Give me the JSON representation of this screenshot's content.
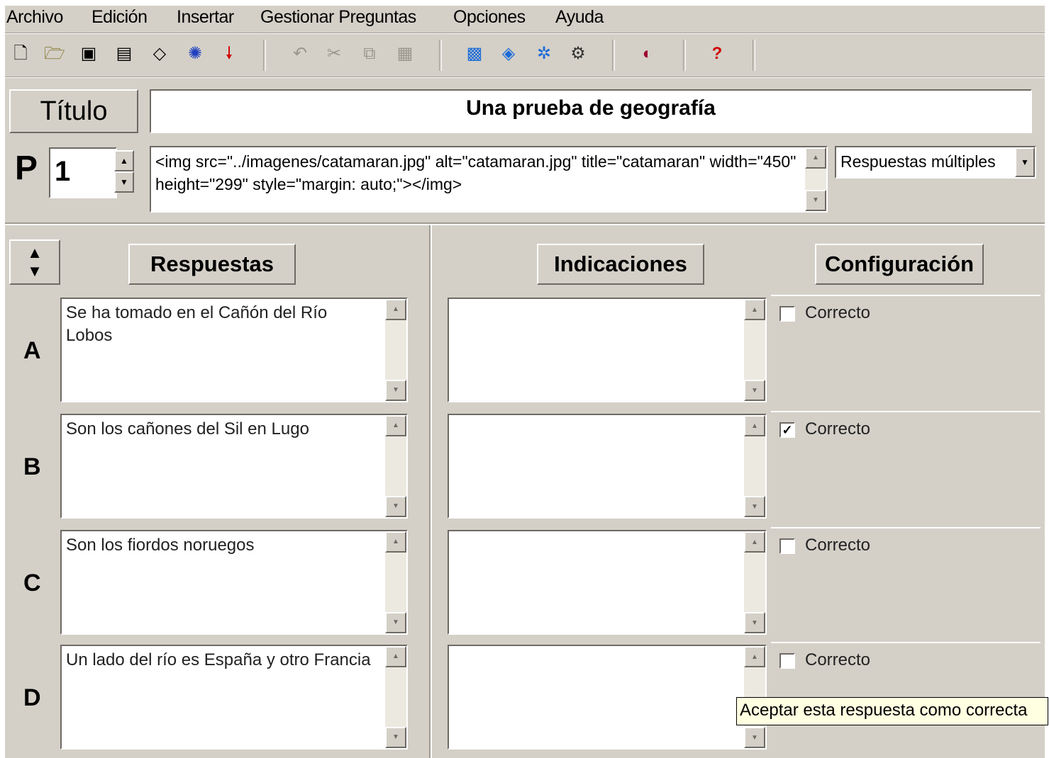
{
  "menu": [
    {
      "label": "Archivo"
    },
    {
      "label": "Edición"
    },
    {
      "label": "Insertar"
    },
    {
      "label": "Gestionar Preguntas"
    },
    {
      "label": "Opciones"
    },
    {
      "label": "Ayuda"
    }
  ],
  "toolbar": {
    "icons": [
      "new-file-icon",
      "open-folder-icon",
      "save-icon",
      "save-as-icon",
      "eraser-icon",
      "network-icon",
      "insert-arrow-icon",
      "undo-icon",
      "cut-icon",
      "copy-icon",
      "paste-icon",
      "image-icon",
      "media-icon",
      "link-icon",
      "config-icon",
      "preview-icon",
      "help-icon"
    ]
  },
  "title": {
    "label": "Título",
    "value": "Una prueba de geografía"
  },
  "question": {
    "p_label": "P",
    "number": "1",
    "text": "<img src=\"../imagenes/catamaran.jpg\" alt=\"catamaran.jpg\" title=\"catamaran\" width=\"450\" height=\"299\" style=\"margin: auto;\"></img>",
    "type": "Respuestas múltiples"
  },
  "headers": {
    "respuestas": "Respuestas",
    "indicaciones": "Indicaciones",
    "configuracion": "Configuración"
  },
  "answers": [
    {
      "letter": "A",
      "text": "Se ha tomado en el Cañón del Río Lobos",
      "indicacion": "",
      "correct_label": "Correcto",
      "checked": false
    },
    {
      "letter": "B",
      "text": "Son los cañones del Sil en Lugo",
      "indicacion": "",
      "correct_label": "Correcto",
      "checked": true
    },
    {
      "letter": "C",
      "text": "Son los fiordos noruegos",
      "indicacion": "",
      "correct_label": "Correcto",
      "checked": false
    },
    {
      "letter": "D",
      "text": "Un lado del río es España y otro Francia",
      "indicacion": "",
      "correct_label": "Correcto",
      "checked": false
    }
  ],
  "tooltip": "Aceptar esta respuesta como correcta"
}
